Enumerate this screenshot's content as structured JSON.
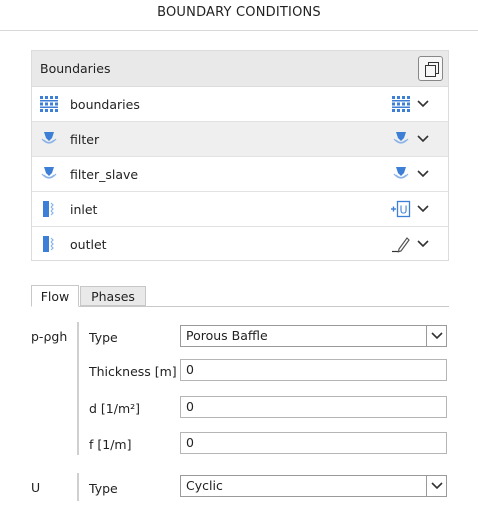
{
  "window": {
    "title": "BOUNDARY CONDITIONS"
  },
  "boundaries": {
    "header": "Boundaries",
    "copy_icon": "copy-icon",
    "items": [
      {
        "label": "boundaries",
        "left_icon": "mesh-icon",
        "right_icon": "mesh-icon",
        "selected": false
      },
      {
        "label": "filter",
        "left_icon": "baffle-icon",
        "right_icon": "baffle-icon",
        "selected": true
      },
      {
        "label": "filter_slave",
        "left_icon": "baffle-icon",
        "right_icon": "baffle-icon",
        "selected": false
      },
      {
        "label": "inlet",
        "left_icon": "patch-icon",
        "right_icon": "velocity-inlet-icon",
        "right_text": "U",
        "selected": false
      },
      {
        "label": "outlet",
        "left_icon": "patch-icon",
        "right_icon": "pencil-icon",
        "selected": false
      }
    ]
  },
  "tabs": [
    {
      "label": "Flow",
      "active": true
    },
    {
      "label": "Phases",
      "active": false
    }
  ],
  "fields": {
    "p_rgh": {
      "label": "p-ρgh",
      "type_label": "Type",
      "type_value": "Porous Baffle",
      "thickness_label": "Thickness [m]",
      "thickness_value": "0",
      "d_label": "d [1/m²]",
      "d_value": "0",
      "f_label": "f [1/m]",
      "f_value": "0"
    },
    "U": {
      "label": "U",
      "type_label": "Type",
      "type_value": "Cyclic"
    }
  },
  "colors": {
    "icon_blue": "#3d7fd6",
    "selected_row": "#efefef",
    "header_bg": "#e9e9e9"
  }
}
